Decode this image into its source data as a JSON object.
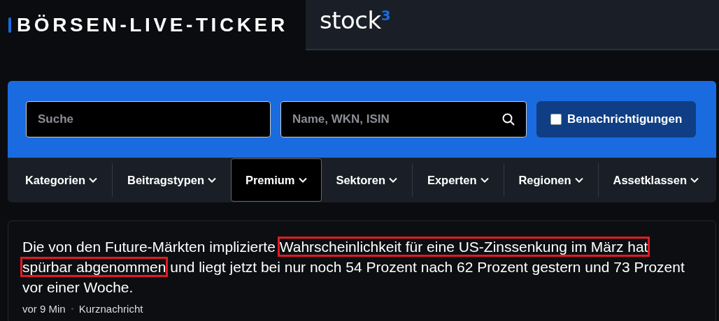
{
  "header": {
    "title": "BÖRSEN-LIVE-TICKER",
    "logo": {
      "text": "stock",
      "superscript": "3"
    }
  },
  "search": {
    "placeholder": "Suche"
  },
  "symbol_search": {
    "placeholder": "Name, WKN, ISIN"
  },
  "notifications": {
    "label": "Benachrichtigungen",
    "checked": false
  },
  "nav": [
    {
      "label": "Kategorien",
      "selected": false
    },
    {
      "label": "Beitragstypen",
      "selected": false
    },
    {
      "label": "Premium",
      "selected": true
    },
    {
      "label": "Sektoren",
      "selected": false
    },
    {
      "label": "Experten",
      "selected": false
    },
    {
      "label": "Regionen",
      "selected": false
    },
    {
      "label": "Assetklassen",
      "selected": false
    }
  ],
  "post": {
    "text_parts": [
      {
        "text": "Die von den Future-Märkten implizierte ",
        "highlighted": false
      },
      {
        "text": "Wahrscheinlichkeit für eine US-Zinssenkung im März hat spürbar abgenommen",
        "highlighted": true
      },
      {
        "text": " und liegt jetzt bei nur noch 54 Prozent nach 62 Prozent gestern und 73 Prozent vor einer Woche.",
        "highlighted": false
      }
    ],
    "time": "vor 9 Min",
    "type": "Kurznachricht"
  }
}
